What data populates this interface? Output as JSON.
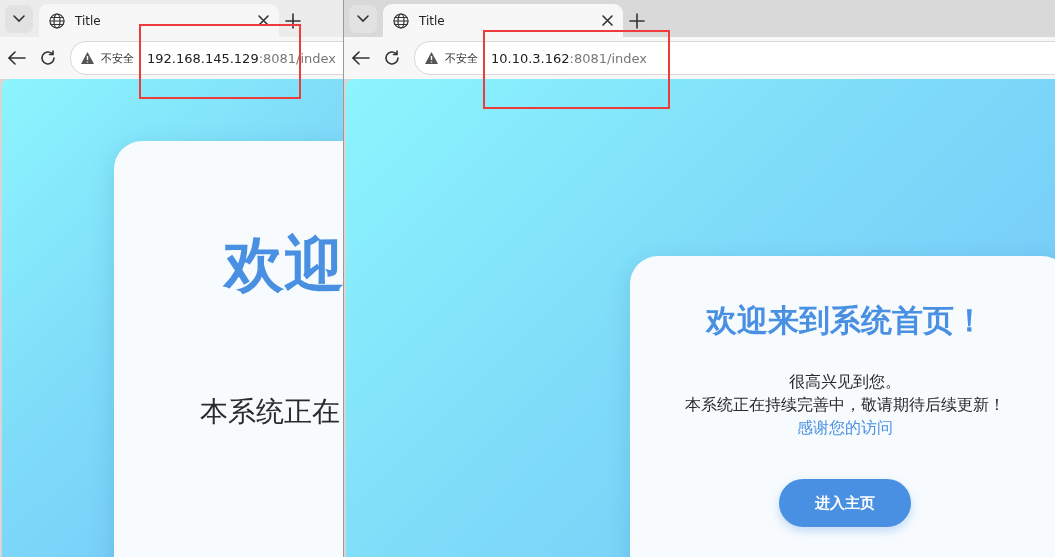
{
  "windows": [
    {
      "tab": {
        "title": "Title"
      },
      "address": {
        "security": "不安全",
        "host": "192.168.145.129",
        "rest": ":8081/index",
        "marked": true
      },
      "page": {
        "heading": "欢迎",
        "lines": [
          "本系统正在"
        ]
      }
    },
    {
      "tab": {
        "title": "Title"
      },
      "address": {
        "security": "不安全",
        "host": "10.10.3.162",
        "rest": ":8081/index",
        "marked": true
      },
      "page": {
        "heading": "欢迎来到系统首页！",
        "lines": [
          "很高兴见到您。",
          "本系统正在持续完善中，敬请期待后续更新！"
        ],
        "link": "感谢您的访问",
        "button": "进入主页"
      }
    }
  ]
}
